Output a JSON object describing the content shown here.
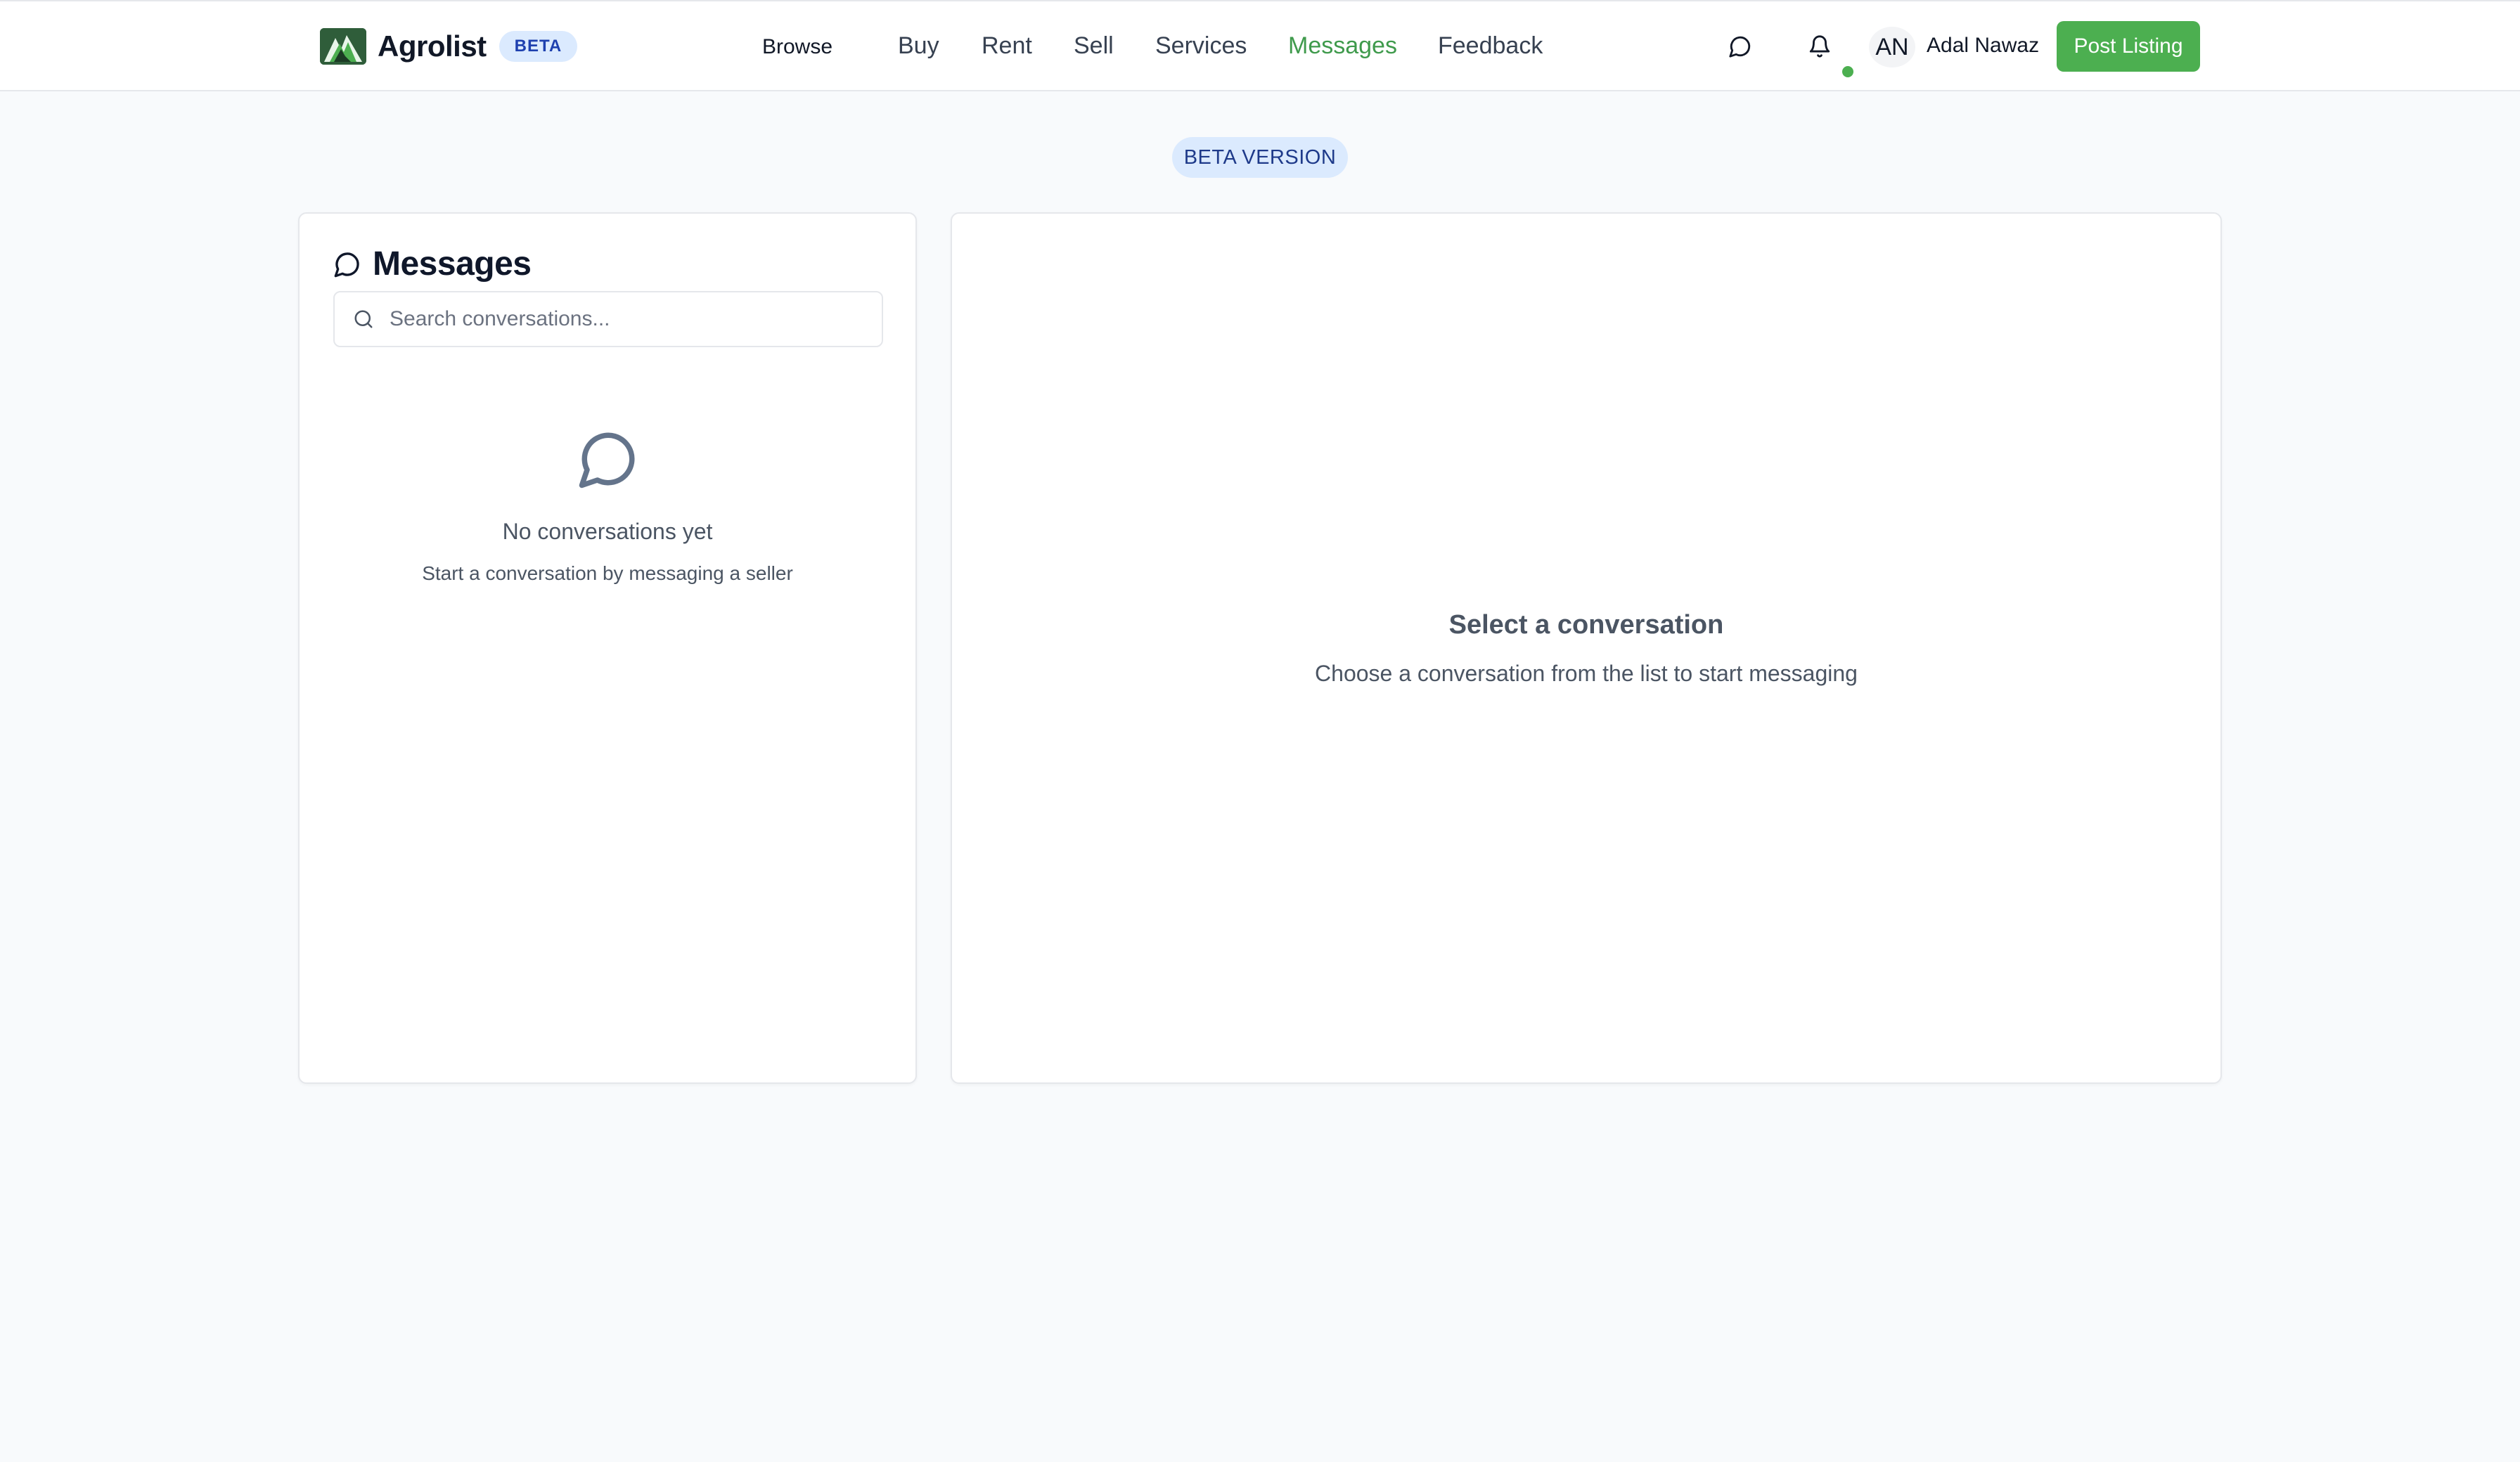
{
  "header": {
    "brand": "Agrolist",
    "beta_badge": "BETA",
    "nav": {
      "browse": "Browse",
      "buy": "Buy",
      "rent": "Rent",
      "sell": "Sell",
      "services": "Services",
      "messages": "Messages",
      "feedback": "Feedback"
    },
    "active_nav": "Messages",
    "user_initials": "AN",
    "user_name": "Adal Nawaz",
    "post_listing": "Post Listing"
  },
  "beta_version": "BETA VERSION",
  "conversations": {
    "title": "Messages",
    "search_placeholder": "Search conversations...",
    "empty_title": "No conversations yet",
    "empty_subtitle": "Start a conversation by messaging a seller"
  },
  "detail": {
    "title": "Select a conversation",
    "subtitle": "Choose a conversation from the list to start messaging"
  },
  "colors": {
    "accent": "#4caf50",
    "active_nav": "#3f9a4c",
    "beta_bg": "#dbeafe",
    "beta_text": "#1e40af",
    "page_bg": "#f8fafc"
  }
}
